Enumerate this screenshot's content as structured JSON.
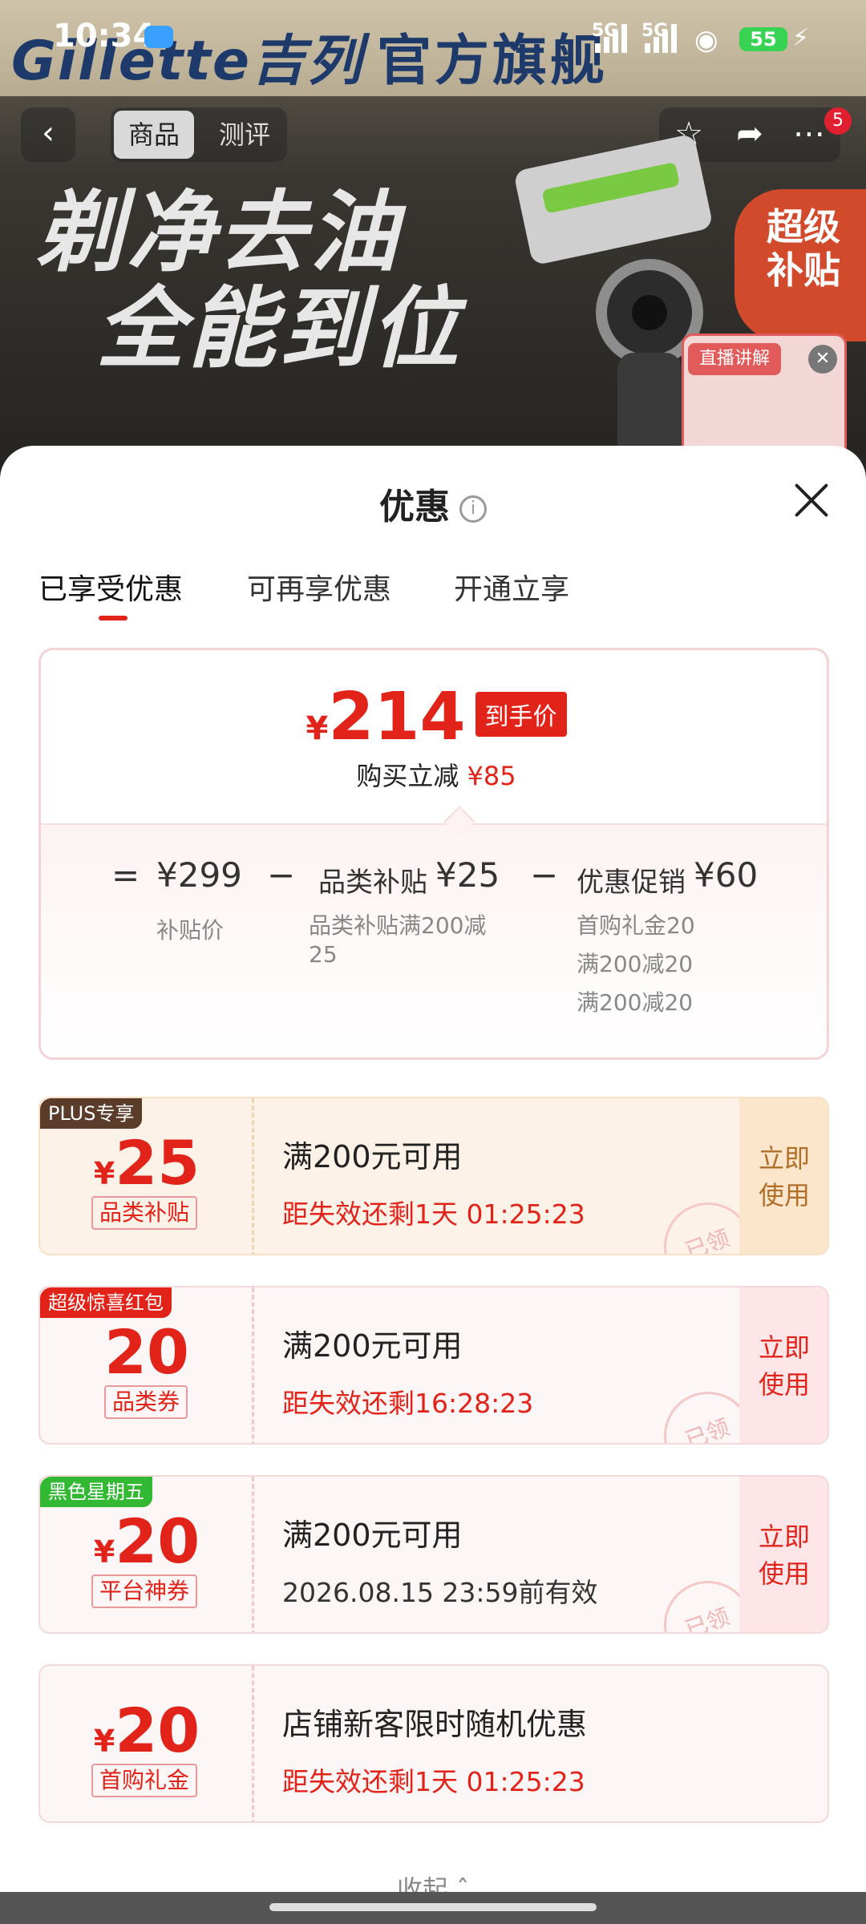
{
  "status": {
    "time": "10:34",
    "net1": "5G",
    "net2": "5G",
    "battery": "55"
  },
  "banner": {
    "brand_left": "Gillette吉列",
    "brand_right": "官方旗舰",
    "tabs": [
      "商品",
      "测评"
    ],
    "notif_count": "5",
    "slogan_line1": "剃净去油",
    "slogan_line2": "全能到位",
    "super_subsidy": [
      "超级",
      "补贴"
    ],
    "live_tag": "直播讲解"
  },
  "sheet": {
    "title": "优惠",
    "tabs": [
      "已享受优惠",
      "可再享优惠",
      "开通立享"
    ],
    "summary": {
      "yen": "¥",
      "final_price": "214",
      "final_tag": "到手价",
      "cut_label": "购买立减",
      "cut_value": "¥85",
      "eq": "=",
      "base_price": "¥299",
      "base_label": "补贴价",
      "minus1": "−",
      "subsidy_label": "品类补贴",
      "subsidy_value": "¥25",
      "subsidy_note": "品类补贴满200减25",
      "minus2": "−",
      "promo_label": "优惠促销",
      "promo_value": "¥60",
      "promo_items": [
        "首购礼金20",
        "满200减20",
        "满200减20"
      ]
    },
    "coupons": [
      {
        "ribbon": "PLUS专享",
        "yen": "¥",
        "amount": "25",
        "kind": "品类补贴",
        "cond": "满200元可用",
        "expire": "距失效还剩1天 01:25:23",
        "use": [
          "立即",
          "使用"
        ],
        "stamp": "已领"
      },
      {
        "ribbon": "超级惊喜红包",
        "yen": "",
        "amount": "20",
        "kind": "品类券",
        "cond": "满200元可用",
        "expire": "距失效还剩16:28:23",
        "use": [
          "立即",
          "使用"
        ],
        "stamp": "已领"
      },
      {
        "ribbon": "黑色星期五",
        "yen": "¥",
        "amount": "20",
        "kind": "平台神券",
        "cond": "满200元可用",
        "expire": "2026.08.15 23:59前有效",
        "use": [
          "立即",
          "使用"
        ],
        "stamp": "已领"
      },
      {
        "ribbon": "",
        "yen": "¥",
        "amount": "20",
        "kind": "首购礼金",
        "cond": "店铺新客限时随机优惠",
        "expire": "距失效还剩1天 01:25:23"
      }
    ],
    "collapse": "收起"
  },
  "colors": {
    "accent": "#e2231a",
    "plus_bg": "#fdf2e8",
    "ribbon_green": "#33b833"
  }
}
